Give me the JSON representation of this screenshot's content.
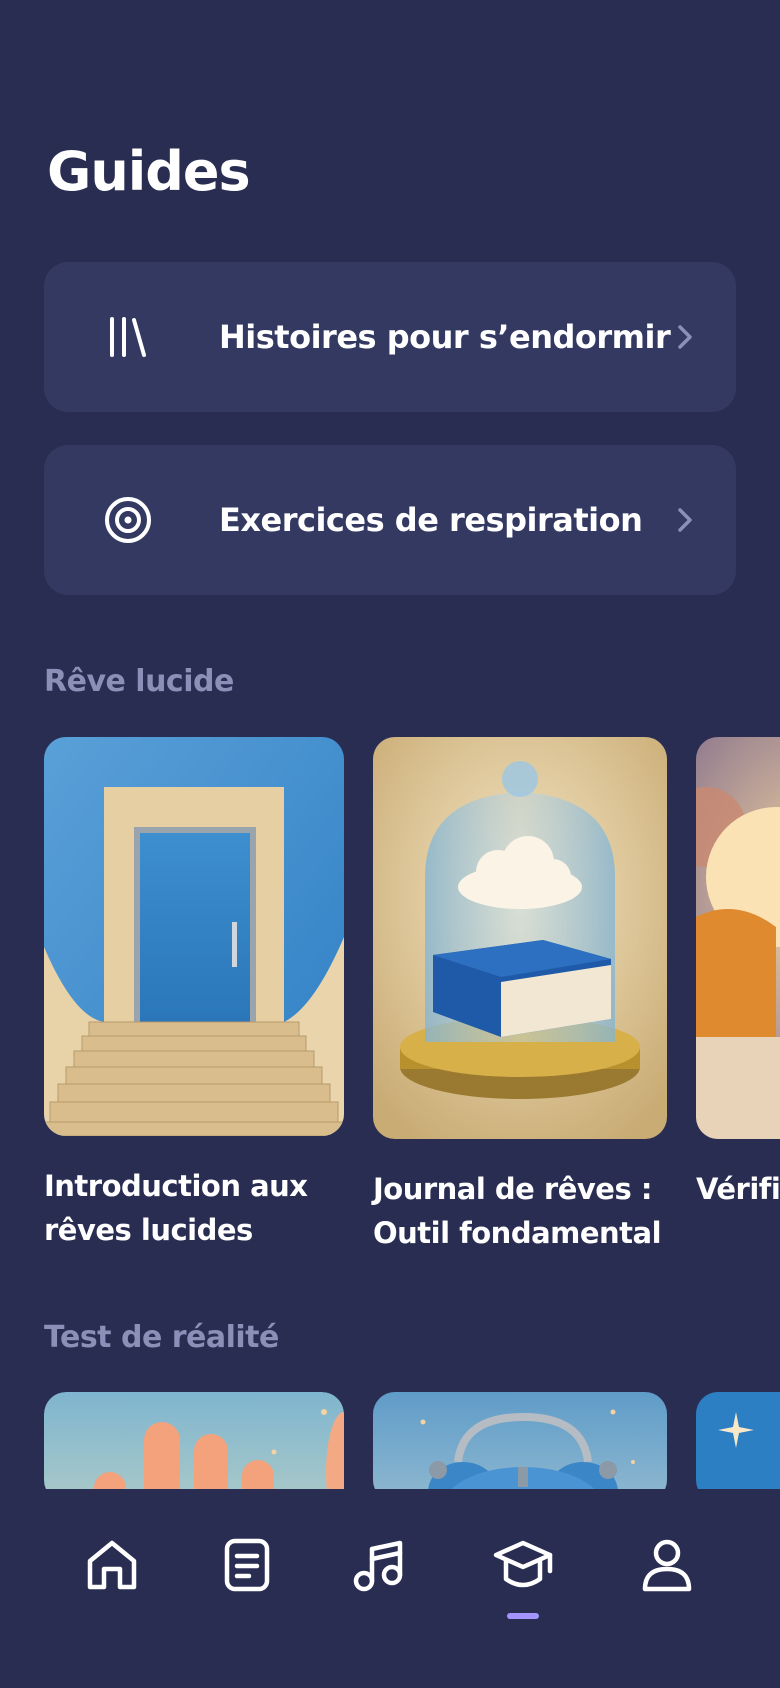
{
  "header": {
    "title": "Guides"
  },
  "menu": [
    {
      "label": "Histoires pour s’endormir",
      "icon": "library-icon"
    },
    {
      "label": "Exercices de respiration",
      "icon": "target-icon"
    }
  ],
  "sections": [
    {
      "title": "Rêve lucide",
      "items": [
        {
          "title": "Introduction aux rêves lucides",
          "image": "door-stairs-image"
        },
        {
          "title": "Journal de rêves : Outil fondamental",
          "image": "cloud-book-jar-image"
        },
        {
          "title": "Vérific réalité",
          "image": "lamp-cloud-image"
        }
      ]
    },
    {
      "title": "Test de réalité",
      "items": [
        {
          "image": "hand-image"
        },
        {
          "image": "alarm-clock-image"
        },
        {
          "image": "sparkle-sky-image"
        }
      ]
    }
  ],
  "nav": {
    "items": [
      "home-icon",
      "journal-icon",
      "music-icon",
      "graduation-cap-icon",
      "profile-icon"
    ],
    "active": "graduation-cap-icon",
    "accent": "#a394ff"
  }
}
